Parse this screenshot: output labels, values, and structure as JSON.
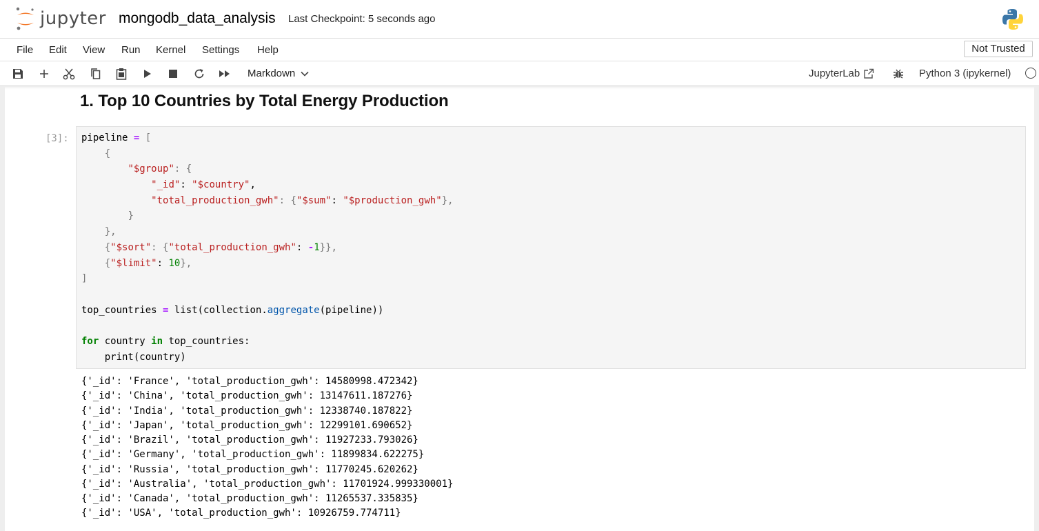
{
  "header": {
    "logo_text": "jupyter",
    "notebook_title": "mongodb_data_analysis",
    "checkpoint": "Last Checkpoint: 5 seconds ago"
  },
  "menu": {
    "items": [
      "File",
      "Edit",
      "View",
      "Run",
      "Kernel",
      "Settings",
      "Help"
    ],
    "trust_label": "Not Trusted"
  },
  "toolbar": {
    "icons": [
      "save-icon",
      "add-cell-icon",
      "cut-icon",
      "copy-icon",
      "paste-icon",
      "run-icon",
      "stop-icon",
      "restart-icon",
      "fast-forward-icon"
    ],
    "cell_type": "Markdown",
    "jupyterlab_label": "JupyterLab",
    "kernel_name": "Python 3 (ipykernel)"
  },
  "notebook": {
    "markdown_heading": "1. Top 10 Countries by Total Energy Production",
    "code_prompt": "[3]:",
    "code": {
      "l1_a": "pipeline",
      "l1_op": "=",
      "l1_b": "[",
      "l2": "{",
      "l3_key": "\"$group\"",
      "l3_rest": ": {",
      "l4_key": "\"_id\"",
      "l4_colon": ": ",
      "l4_val": "\"$country\"",
      "l4_end": ",",
      "l5_key": "\"total_production_gwh\"",
      "l5_colon": ": {",
      "l5_sumkey": "\"$sum\"",
      "l5_sumcolon": ": ",
      "l5_sumval": "\"$production_gwh\"",
      "l5_end": "},",
      "l6": "}",
      "l7": "},",
      "l8_open": "{",
      "l8_key": "\"$sort\"",
      "l8_colon": ": {",
      "l8_inner": "\"total_production_gwh\"",
      "l8_colon2": ": ",
      "l8_minus": "-",
      "l8_num": "1",
      "l8_end": "}},",
      "l9_open": "{",
      "l9_key": "\"$limit\"",
      "l9_colon": ": ",
      "l9_num": "10",
      "l9_end": "},",
      "l10": "]",
      "l12_var": "top_countries ",
      "l12_op": "=",
      "l12_a": " list(collection.",
      "l12_fn": "aggregate",
      "l12_b": "(pipeline))",
      "l14_kw1": "for",
      "l14_a": " country ",
      "l14_kw2": "in",
      "l14_b": " top_countries:",
      "l15": "print(country)"
    },
    "output": [
      "{'_id': 'France', 'total_production_gwh': 14580998.472342}",
      "{'_id': 'China', 'total_production_gwh': 13147611.187276}",
      "{'_id': 'India', 'total_production_gwh': 12338740.187822}",
      "{'_id': 'Japan', 'total_production_gwh': 12299101.690652}",
      "{'_id': 'Brazil', 'total_production_gwh': 11927233.793026}",
      "{'_id': 'Germany', 'total_production_gwh': 11899834.622275}",
      "{'_id': 'Russia', 'total_production_gwh': 11770245.620262}",
      "{'_id': 'Australia', 'total_production_gwh': 11701924.999330001}",
      "{'_id': 'Canada', 'total_production_gwh': 11265537.335835}",
      "{'_id': 'USA', 'total_production_gwh': 10926759.774711}"
    ]
  }
}
